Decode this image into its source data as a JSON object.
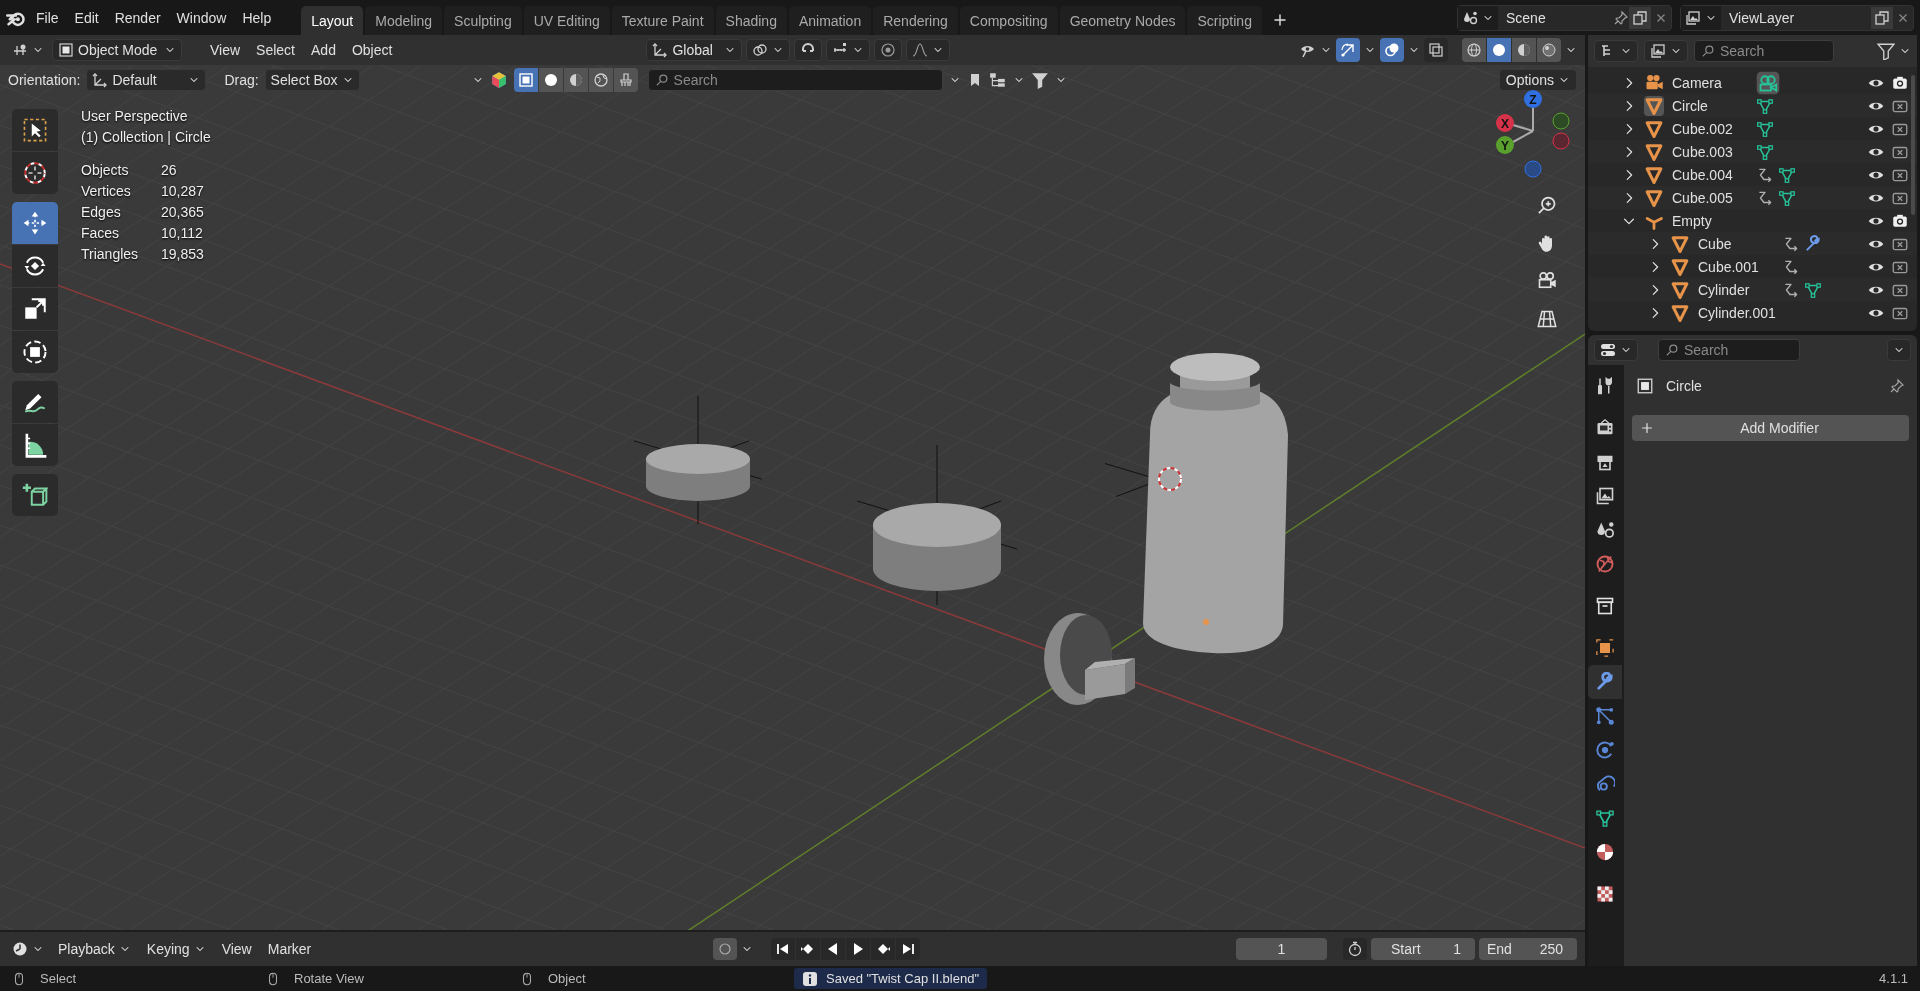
{
  "menu_bar": {
    "menus": [
      "File",
      "Edit",
      "Render",
      "Window",
      "Help"
    ]
  },
  "workspace_tabs": [
    {
      "label": "Layout",
      "selected": true
    },
    {
      "label": "Modeling",
      "selected": false
    },
    {
      "label": "Sculpting",
      "selected": false
    },
    {
      "label": "UV Editing",
      "selected": false
    },
    {
      "label": "Texture Paint",
      "selected": false
    },
    {
      "label": "Shading",
      "selected": false
    },
    {
      "label": "Animation",
      "selected": false
    },
    {
      "label": "Rendering",
      "selected": false
    },
    {
      "label": "Compositing",
      "selected": false
    },
    {
      "label": "Geometry Nodes",
      "selected": false
    },
    {
      "label": "Scripting",
      "selected": false
    }
  ],
  "scene": {
    "name": "Scene"
  },
  "view_layer": {
    "name": "ViewLayer"
  },
  "viewport_header": {
    "mode": "Object Mode",
    "menus": [
      "View",
      "Select",
      "Add",
      "Object"
    ],
    "orientation": "Global",
    "toggles": [
      {
        "kind": "gizmos",
        "on": true
      },
      {
        "kind": "overlays",
        "on": true
      },
      {
        "kind": "xray",
        "on": false
      }
    ],
    "shading": [
      {
        "kind": "wireframe",
        "selected": false
      },
      {
        "kind": "solid",
        "selected": true
      },
      {
        "kind": "material",
        "selected": false
      },
      {
        "kind": "rendered",
        "selected": false
      }
    ]
  },
  "tool_settings": {
    "orientation_label": "Orientation:",
    "orientation": "Default",
    "drag_label": "Drag:",
    "drag": "Select Box",
    "select_modes": [
      {
        "kind": "box",
        "selected": true
      },
      {
        "kind": "solid",
        "selected": false
      },
      {
        "kind": "material",
        "selected": false
      },
      {
        "kind": "world",
        "selected": false
      },
      {
        "kind": "brush",
        "selected": false
      }
    ],
    "search_placeholder": "Search",
    "options": "Options"
  },
  "toolbar": {
    "groups": [
      {
        "tools": [
          {
            "kind": "select_box",
            "selected": false
          },
          {
            "kind": "cursor",
            "selected": false
          }
        ]
      },
      {
        "tools": [
          {
            "kind": "move",
            "selected": true
          },
          {
            "kind": "rotate",
            "selected": false
          },
          {
            "kind": "scale",
            "selected": false
          },
          {
            "kind": "transform",
            "selected": false
          }
        ]
      },
      {
        "tools": [
          {
            "kind": "annotate",
            "selected": false
          },
          {
            "kind": "measure",
            "selected": false
          }
        ]
      },
      {
        "tools": [
          {
            "kind": "add_cube",
            "selected": false
          }
        ]
      }
    ]
  },
  "overlay_info": {
    "view": "User Perspective",
    "context": "(1) Collection | Circle",
    "stats": [
      {
        "label": "Objects",
        "value": "26"
      },
      {
        "label": "Vertices",
        "value": "10,287"
      },
      {
        "label": "Edges",
        "value": "20,365"
      },
      {
        "label": "Faces",
        "value": "10,112"
      },
      {
        "label": "Triangles",
        "value": "19,853"
      }
    ]
  },
  "gizmo": {
    "axes": [
      {
        "kind": "z",
        "label": "Z"
      },
      {
        "kind": "x",
        "label": "X"
      },
      {
        "kind": "y",
        "label": "Y"
      }
    ]
  },
  "outliner": {
    "search_placeholder": "Search",
    "items": [
      {
        "name": "Camera",
        "kind": "camera",
        "expanded": false,
        "active": false,
        "badges": [
          {
            "kind": "camera_data"
          }
        ],
        "renderable": true
      },
      {
        "name": "Circle",
        "kind": "mesh",
        "expanded": false,
        "active": true,
        "badges": [
          {
            "kind": "mesh_data"
          }
        ],
        "renderable": false
      },
      {
        "name": "Cube.002",
        "kind": "mesh",
        "expanded": false,
        "active": false,
        "badges": [
          {
            "kind": "mesh_data"
          }
        ],
        "renderable": false
      },
      {
        "name": "Cube.003",
        "kind": "mesh",
        "expanded": false,
        "active": false,
        "badges": [
          {
            "kind": "mesh_data"
          }
        ],
        "renderable": false
      },
      {
        "name": "Cube.004",
        "kind": "mesh",
        "expanded": false,
        "active": false,
        "badges": [
          {
            "kind": "child"
          },
          {
            "kind": "mesh_data"
          }
        ],
        "renderable": false
      },
      {
        "name": "Cube.005",
        "kind": "mesh",
        "expanded": false,
        "active": false,
        "badges": [
          {
            "kind": "child"
          },
          {
            "kind": "mesh_data"
          }
        ],
        "renderable": false
      },
      {
        "name": "Empty",
        "kind": "empty",
        "expanded": true,
        "active": false,
        "renderable": true,
        "children": [
          {
            "name": "Cube",
            "kind": "mesh",
            "expanded": false,
            "active": false,
            "badges": [
              {
                "kind": "child"
              },
              {
                "kind": "modifier"
              }
            ],
            "renderable": false
          },
          {
            "name": "Cube.001",
            "kind": "mesh",
            "expanded": false,
            "active": false,
            "badges": [
              {
                "kind": "child"
              }
            ],
            "renderable": false
          },
          {
            "name": "Cylinder",
            "kind": "mesh",
            "expanded": false,
            "active": false,
            "badges": [
              {
                "kind": "child"
              },
              {
                "kind": "mesh_data"
              }
            ],
            "renderable": false
          },
          {
            "name": "Cylinder.001",
            "kind": "mesh",
            "expanded": false,
            "active": false,
            "renderable": false
          }
        ]
      }
    ]
  },
  "properties": {
    "search_placeholder": "Search",
    "object_name": "Circle",
    "add_modifier": "Add Modifier",
    "tab_groups": [
      {
        "tabs": [
          {
            "kind": "tool",
            "selected": false
          }
        ]
      },
      {
        "tabs": [
          {
            "kind": "render",
            "selected": false
          },
          {
            "kind": "output",
            "selected": false
          },
          {
            "kind": "view_layer",
            "selected": false
          },
          {
            "kind": "scene",
            "selected": false
          },
          {
            "kind": "world",
            "selected": false
          }
        ]
      },
      {
        "tabs": [
          {
            "kind": "collection",
            "selected": false
          }
        ]
      },
      {
        "tabs": [
          {
            "kind": "object",
            "selected": false
          },
          {
            "kind": "modifier",
            "selected": true
          },
          {
            "kind": "particles",
            "selected": false
          },
          {
            "kind": "physics",
            "selected": false
          },
          {
            "kind": "constraints",
            "selected": false
          },
          {
            "kind": "data",
            "selected": false
          },
          {
            "kind": "material",
            "selected": false
          }
        ]
      },
      {
        "tabs": [
          {
            "kind": "texture",
            "selected": false
          }
        ]
      }
    ]
  },
  "timeline": {
    "menus": [
      "Playback",
      "Keying",
      "View",
      "Marker"
    ],
    "current_frame": "1",
    "start_label": "Start",
    "start": "1",
    "end_label": "End",
    "end": "250"
  },
  "status_bar": {
    "hints": [
      "Select",
      "Rotate View",
      "Object"
    ],
    "message": "Saved \"Twist Cap II.blend\"",
    "version": "4.1.1"
  }
}
